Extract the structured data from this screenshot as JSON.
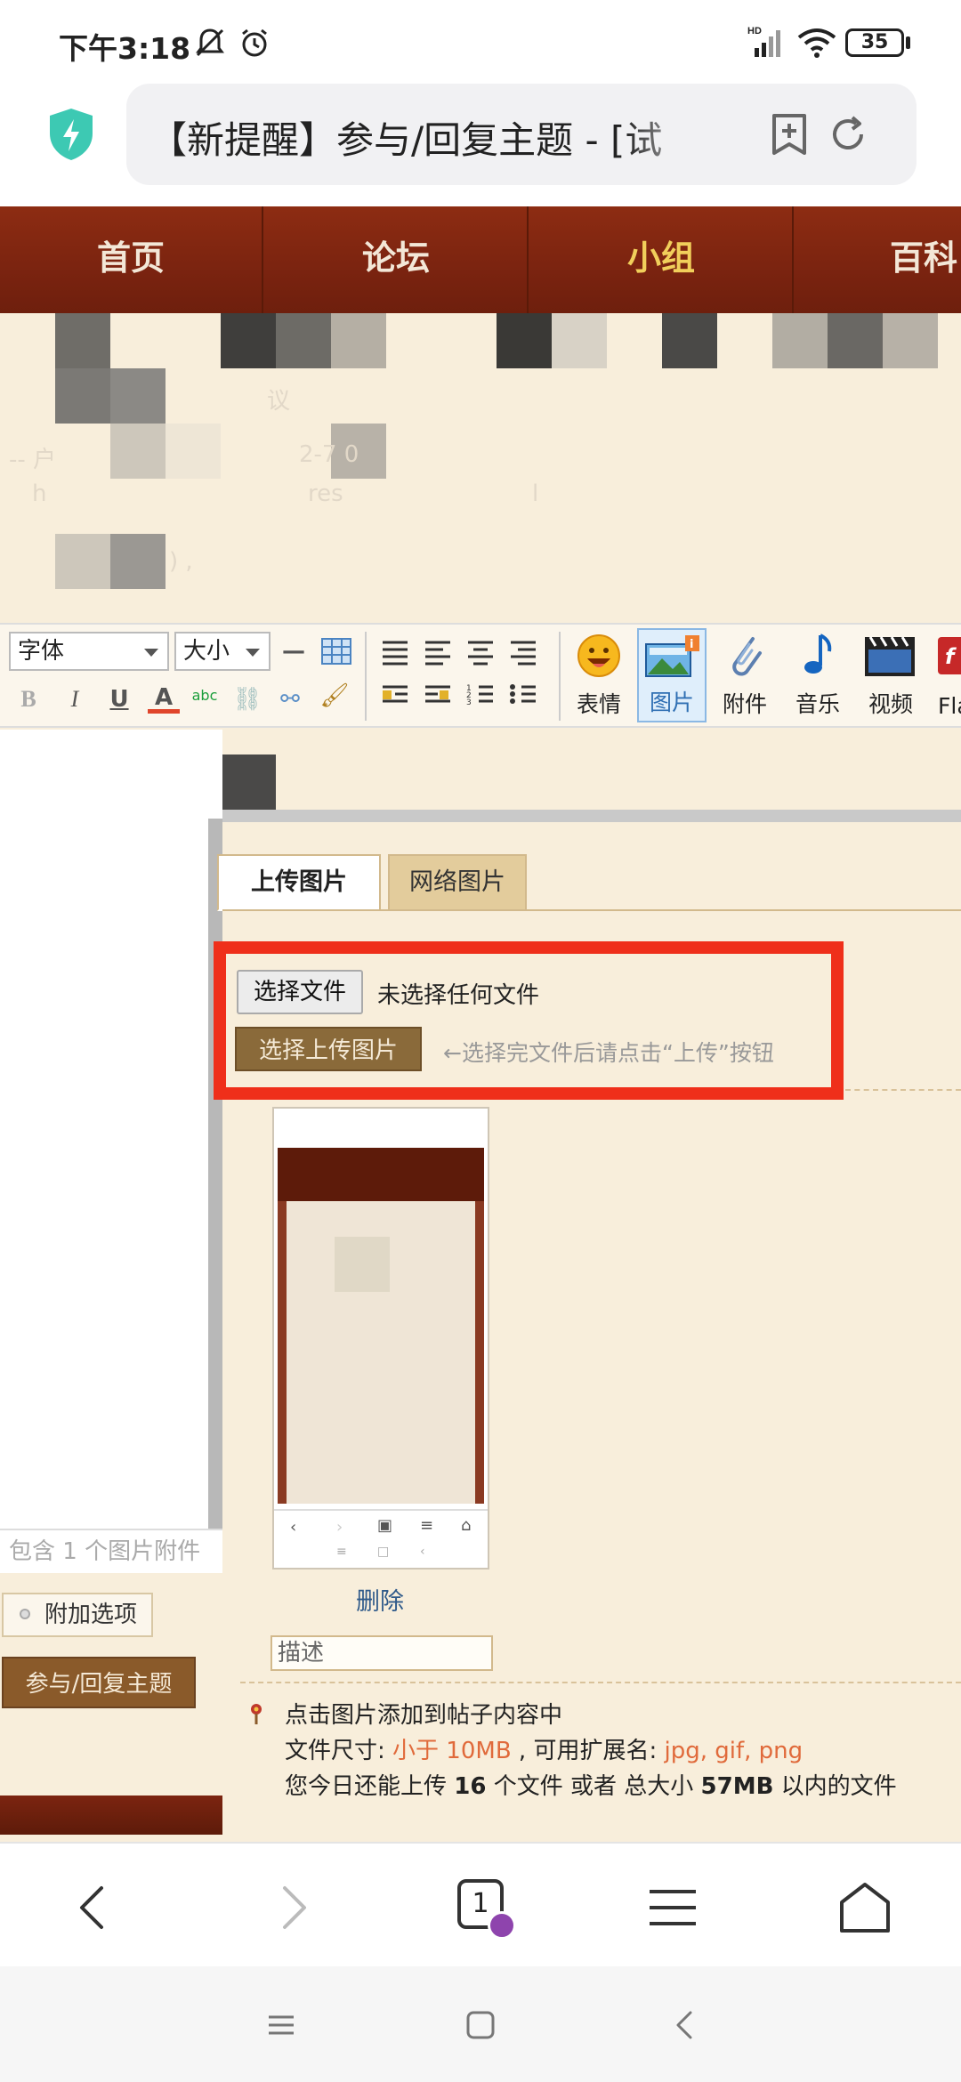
{
  "status_bar": {
    "time": "下午3:18",
    "network": "HD",
    "battery": "35"
  },
  "address_bar": {
    "title": "【新提醒】参与/回复主题 - [试",
    "shield_color": "#3dc9b3"
  },
  "site_nav": {
    "items": [
      {
        "label": "首页",
        "active": false
      },
      {
        "label": "论坛",
        "active": false
      },
      {
        "label": "小组",
        "active": true
      },
      {
        "label": "百科",
        "active": false
      }
    ]
  },
  "toolbar": {
    "font_select": "字体",
    "size_select": "大小",
    "buttons": [
      {
        "label": "表情",
        "icon": "smiley-icon"
      },
      {
        "label": "图片",
        "icon": "image-icon",
        "selected": true
      },
      {
        "label": "附件",
        "icon": "paperclip-icon"
      },
      {
        "label": "音乐",
        "icon": "music-note-icon"
      },
      {
        "label": "视频",
        "icon": "video-icon"
      },
      {
        "label": "Fla",
        "icon": "flash-icon"
      }
    ]
  },
  "left_panel": {
    "attach_info": "包含 1 个图片附件",
    "extra_options": "附加选项",
    "reply_button": "参与/回复主题"
  },
  "upload_dialog": {
    "tabs": [
      {
        "label": "上传图片",
        "active": true
      },
      {
        "label": "网络图片",
        "active": false
      }
    ],
    "choose_file": "选择文件",
    "no_file": "未选择任何文件",
    "upload_button": "选择上传图片",
    "upload_hint": "←选择完文件后请点击“上传”按钮",
    "delete_link": "删除",
    "description_placeholder": "描述",
    "info": {
      "line1": "点击图片添加到帖子内容中",
      "size_label": "文件尺寸: ",
      "size_value": "小于 10MB",
      "ext_label": " , 可用扩展名: ",
      "ext_value": "jpg, gif, png",
      "remaining_prefix": "您今日还能上传 ",
      "remaining_count": "16",
      "remaining_mid": " 个文件 或者 总大小 ",
      "remaining_size": "57MB",
      "remaining_suffix": " 以内的文件"
    },
    "frame_color": "#ef2f1a"
  },
  "browser_nav": {
    "tab_count": "1"
  }
}
